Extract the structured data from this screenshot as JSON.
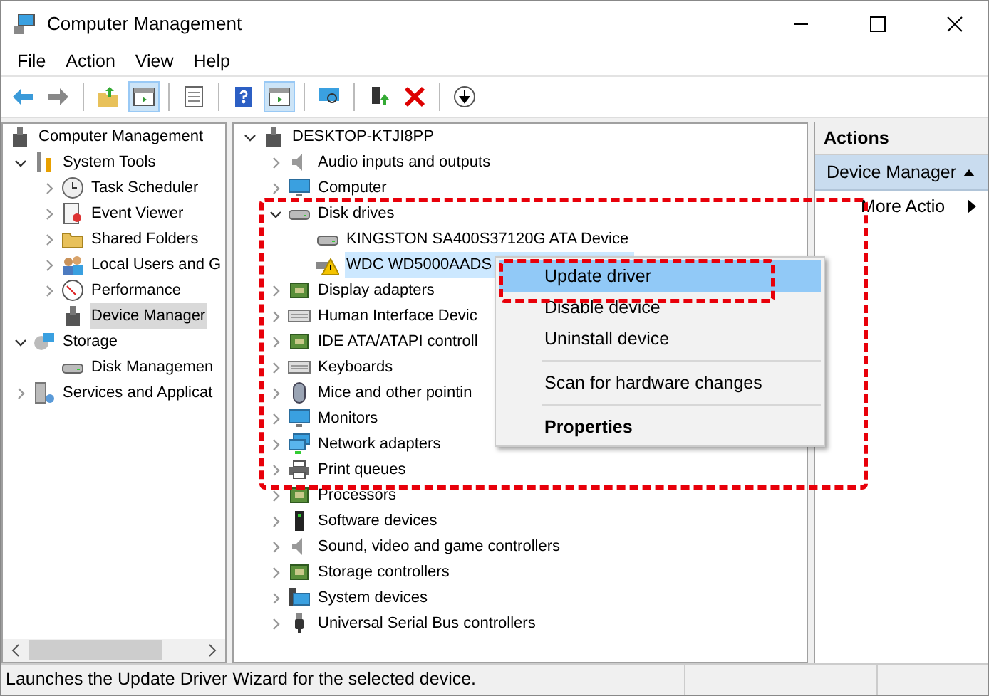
{
  "window": {
    "title": "Computer Management"
  },
  "menu_bar": [
    "File",
    "Action",
    "View",
    "Help"
  ],
  "toolbar": [
    {
      "pressed": false
    },
    {
      "pressed": false
    },
    {
      "pressed": false
    },
    {
      "pressed": true
    },
    {
      "pressed": false
    },
    {
      "pressed": false
    },
    {
      "pressed": true
    },
    {
      "pressed": false
    },
    {
      "pressed": false
    },
    {
      "pressed": false
    },
    {
      "pressed": false
    }
  ],
  "console_tree": [
    {
      "label": "Computer Management",
      "expandable": false,
      "selected": false,
      "children": [
        {
          "label": "System Tools",
          "expandable": true,
          "expanded": true,
          "selected": false,
          "children": [
            {
              "label": "Task Scheduler",
              "expandable": true,
              "expanded": false,
              "selected": false
            },
            {
              "label": "Event Viewer",
              "expandable": true,
              "expanded": false,
              "selected": false
            },
            {
              "label": "Shared Folders",
              "expandable": true,
              "expanded": false,
              "selected": false
            },
            {
              "label": "Local Users and G",
              "expandable": true,
              "expanded": false,
              "selected": false
            },
            {
              "label": "Performance",
              "expandable": true,
              "expanded": false,
              "selected": false
            },
            {
              "label": "Device Manager",
              "expandable": false,
              "expanded": false,
              "selected": true
            }
          ]
        },
        {
          "label": "Storage",
          "expandable": true,
          "expanded": true,
          "selected": false,
          "children": [
            {
              "label": "Disk Managemen",
              "expandable": false,
              "expanded": false,
              "selected": false
            }
          ]
        },
        {
          "label": "Services and Applicat",
          "expandable": true,
          "expanded": false,
          "selected": false
        }
      ]
    }
  ],
  "device_tree": [
    {
      "label": "DESKTOP-KTJI8PP",
      "expandable": true,
      "expanded": true,
      "selected": false,
      "children": [
        {
          "label": "Audio inputs and outputs",
          "expandable": true,
          "expanded": false,
          "selected": false
        },
        {
          "label": "Computer",
          "expandable": true,
          "expanded": false,
          "selected": false
        },
        {
          "label": "Disk drives",
          "expandable": true,
          "expanded": true,
          "selected": false,
          "children": [
            {
              "label": "KINGSTON SA400S37120G ATA Device",
              "expandable": false,
              "expanded": false,
              "selected": false
            },
            {
              "label": "WDC WD5000AADS",
              "expandable": false,
              "expanded": false,
              "selected": true
            }
          ]
        },
        {
          "label": "Display adapters",
          "expandable": true,
          "expanded": false,
          "selected": false
        },
        {
          "label": "Human Interface Devic",
          "expandable": true,
          "expanded": false,
          "selected": false
        },
        {
          "label": "IDE ATA/ATAPI controll",
          "expandable": true,
          "expanded": false,
          "selected": false
        },
        {
          "label": "Keyboards",
          "expandable": true,
          "expanded": false,
          "selected": false
        },
        {
          "label": "Mice and other pointin",
          "expandable": true,
          "expanded": false,
          "selected": false
        },
        {
          "label": "Monitors",
          "expandable": true,
          "expanded": false,
          "selected": false
        },
        {
          "label": "Network adapters",
          "expandable": true,
          "expanded": false,
          "selected": false
        },
        {
          "label": "Print queues",
          "expandable": true,
          "expanded": false,
          "selected": false
        },
        {
          "label": "Processors",
          "expandable": true,
          "expanded": false,
          "selected": false
        },
        {
          "label": "Software devices",
          "expandable": true,
          "expanded": false,
          "selected": false
        },
        {
          "label": "Sound, video and game controllers",
          "expandable": true,
          "expanded": false,
          "selected": false
        },
        {
          "label": "Storage controllers",
          "expandable": true,
          "expanded": false,
          "selected": false
        },
        {
          "label": "System devices",
          "expandable": true,
          "expanded": false,
          "selected": false
        },
        {
          "label": "Universal Serial Bus controllers",
          "expandable": true,
          "expanded": false,
          "selected": false
        }
      ]
    }
  ],
  "context_menu": [
    {
      "kind": "item",
      "label": "Update driver",
      "selected": true,
      "default": false
    },
    {
      "kind": "item",
      "label": "Disable device",
      "selected": false,
      "default": false
    },
    {
      "kind": "item",
      "label": "Uninstall device",
      "selected": false,
      "default": false
    },
    {
      "kind": "separator"
    },
    {
      "kind": "item",
      "label": "Scan for hardware changes",
      "selected": false,
      "default": false
    },
    {
      "kind": "separator"
    },
    {
      "kind": "item",
      "label": "Properties",
      "selected": false,
      "default": true
    }
  ],
  "actions_pane": {
    "title": "Actions",
    "section": "Device Manager",
    "expanded": true,
    "items": [
      "More Actio"
    ]
  },
  "status_bar": [
    "Launches the Update Driver Wizard for the selected device."
  ]
}
